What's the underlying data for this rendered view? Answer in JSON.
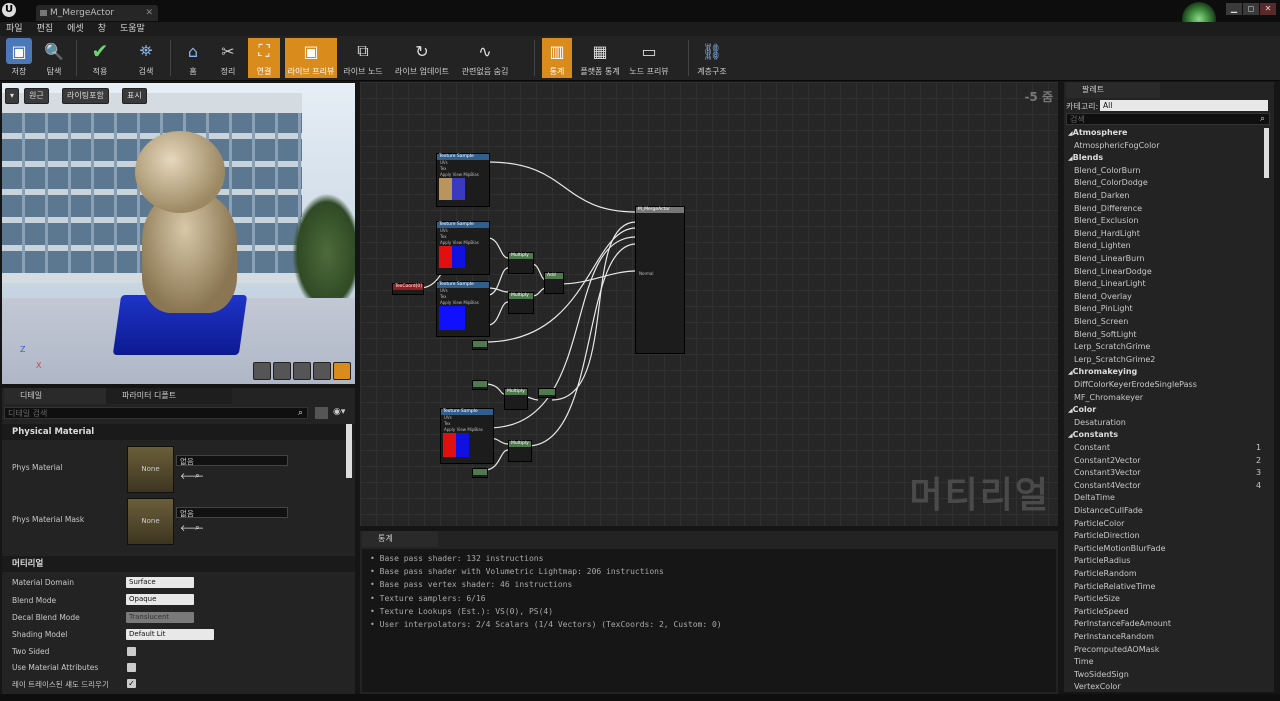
{
  "window": {
    "tab_title": "M_MergeActor",
    "min": "▁",
    "max": "◻",
    "close": "✕"
  },
  "menubar": [
    "파일",
    "편집",
    "에셋",
    "창",
    "도움말"
  ],
  "toolbar": [
    {
      "label": "저장",
      "icon": "save-icon"
    },
    {
      "label": "탐색",
      "icon": "browse-icon"
    },
    {
      "label": "적용",
      "icon": "apply-icon"
    },
    {
      "label": "검색",
      "icon": "search-icon"
    },
    {
      "label": "홈",
      "icon": "home-icon"
    },
    {
      "label": "정리",
      "icon": "clean-icon"
    },
    {
      "label": "연결",
      "icon": "connect-icon"
    },
    {
      "label": "라이브 프리뷰",
      "icon": "live-preview-icon"
    },
    {
      "label": "라이브 노드",
      "icon": "live-nodes-icon"
    },
    {
      "label": "라이브 업데이트",
      "icon": "live-update-icon"
    },
    {
      "label": "관련없음 숨김",
      "icon": "hide-unrelated-icon"
    },
    {
      "label": "통계",
      "icon": "stats-icon"
    },
    {
      "label": "플랫폼 통계",
      "icon": "platform-stats-icon"
    },
    {
      "label": "노드 프리뷰",
      "icon": "node-preview-icon"
    },
    {
      "label": "계층구조",
      "icon": "hierarchy-icon"
    }
  ],
  "viewport": {
    "perspective": "원근",
    "lighting": "라이팅포함",
    "show": "표시",
    "axis_z": "Z",
    "axis_x": "X"
  },
  "details": {
    "tab_details": "디테일",
    "tab_param": "파라미터 디폴트",
    "search_placeholder": "디테일 검색",
    "section_physical": "Physical Material",
    "phys_material": "Phys Material",
    "phys_material_mask": "Phys Material Mask",
    "none": "None",
    "none_value": "없음",
    "section_material": "머티리얼",
    "props": [
      {
        "label": "Material Domain",
        "value": "Surface"
      },
      {
        "label": "Blend Mode",
        "value": "Opaque"
      },
      {
        "label": "Decal Blend Mode",
        "value": "Translucent"
      },
      {
        "label": "Shading Model",
        "value": "Default Lit"
      },
      {
        "label": "Two Sided",
        "value": ""
      },
      {
        "label": "Use Material Attributes",
        "value": ""
      },
      {
        "label": "레이 트레이스된 섀도 드리우기",
        "value": "✓"
      }
    ]
  },
  "graph": {
    "zoom": "-5 줌",
    "watermark": "머티리얼",
    "texture_sample": "Texture Sample",
    "main_node": "M_MergeActor",
    "multiply": "Multiply",
    "add": "Add",
    "texcoord": "TexCoord[0]",
    "pin_uvs": "UVs",
    "pin_tex": "Tex",
    "pin_apply": "Apply View MipBias",
    "pin_rgb": "RGB",
    "pin_rgba": "RGBA",
    "normal": "Normal"
  },
  "stats": {
    "tab": "통계",
    "lines": [
      "Base pass shader: 132 instructions",
      "Base pass shader with Volumetric Lightmap: 206 instructions",
      "Base pass vertex shader: 46 instructions",
      "Texture samplers: 6/16",
      "Texture Lookups (Est.): VS(0), PS(4)",
      "User interpolators: 2/4 Scalars (1/4 Vectors) (TexCoords: 2, Custom: 0)"
    ]
  },
  "palette": {
    "title": "팔레트",
    "category_label": "카테고리:",
    "category_value": "All",
    "search_placeholder": "검색",
    "rows": [
      {
        "type": "cat",
        "text": "Atmosphere"
      },
      {
        "type": "item",
        "text": "AtmosphericFogColor"
      },
      {
        "type": "cat",
        "text": "Blends"
      },
      {
        "type": "item",
        "text": "Blend_ColorBurn"
      },
      {
        "type": "item",
        "text": "Blend_ColorDodge"
      },
      {
        "type": "item",
        "text": "Blend_Darken"
      },
      {
        "type": "item",
        "text": "Blend_Difference"
      },
      {
        "type": "item",
        "text": "Blend_Exclusion"
      },
      {
        "type": "item",
        "text": "Blend_HardLight"
      },
      {
        "type": "item",
        "text": "Blend_Lighten"
      },
      {
        "type": "item",
        "text": "Blend_LinearBurn"
      },
      {
        "type": "item",
        "text": "Blend_LinearDodge"
      },
      {
        "type": "item",
        "text": "Blend_LinearLight"
      },
      {
        "type": "item",
        "text": "Blend_Overlay"
      },
      {
        "type": "item",
        "text": "Blend_PinLight"
      },
      {
        "type": "item",
        "text": "Blend_Screen"
      },
      {
        "type": "item",
        "text": "Blend_SoftLight"
      },
      {
        "type": "item",
        "text": "Lerp_ScratchGrime"
      },
      {
        "type": "item",
        "text": "Lerp_ScratchGrime2"
      },
      {
        "type": "cat",
        "text": "Chromakeying"
      },
      {
        "type": "item",
        "text": "DiffColorKeyerErodeSinglePass"
      },
      {
        "type": "item",
        "text": "MF_Chromakeyer"
      },
      {
        "type": "cat",
        "text": "Color"
      },
      {
        "type": "item",
        "text": "Desaturation"
      },
      {
        "type": "cat",
        "text": "Constants"
      },
      {
        "type": "item",
        "text": "Constant",
        "hotkey": "1"
      },
      {
        "type": "item",
        "text": "Constant2Vector",
        "hotkey": "2"
      },
      {
        "type": "item",
        "text": "Constant3Vector",
        "hotkey": "3"
      },
      {
        "type": "item",
        "text": "Constant4Vector",
        "hotkey": "4"
      },
      {
        "type": "item",
        "text": "DeltaTime"
      },
      {
        "type": "item",
        "text": "DistanceCullFade"
      },
      {
        "type": "item",
        "text": "ParticleColor"
      },
      {
        "type": "item",
        "text": "ParticleDirection"
      },
      {
        "type": "item",
        "text": "ParticleMotionBlurFade"
      },
      {
        "type": "item",
        "text": "ParticleRadius"
      },
      {
        "type": "item",
        "text": "ParticleRandom"
      },
      {
        "type": "item",
        "text": "ParticleRelativeTime"
      },
      {
        "type": "item",
        "text": "ParticleSize"
      },
      {
        "type": "item",
        "text": "ParticleSpeed"
      },
      {
        "type": "item",
        "text": "PerInstanceFadeAmount"
      },
      {
        "type": "item",
        "text": "PerInstanceRandom"
      },
      {
        "type": "item",
        "text": "PrecomputedAOMask"
      },
      {
        "type": "item",
        "text": "Time"
      },
      {
        "type": "item",
        "text": "TwoSidedSign"
      },
      {
        "type": "item",
        "text": "VertexColor"
      }
    ]
  },
  "colors": {
    "accent": "#d98b1c",
    "panel": "#232323",
    "graph_bg": "#262626"
  }
}
